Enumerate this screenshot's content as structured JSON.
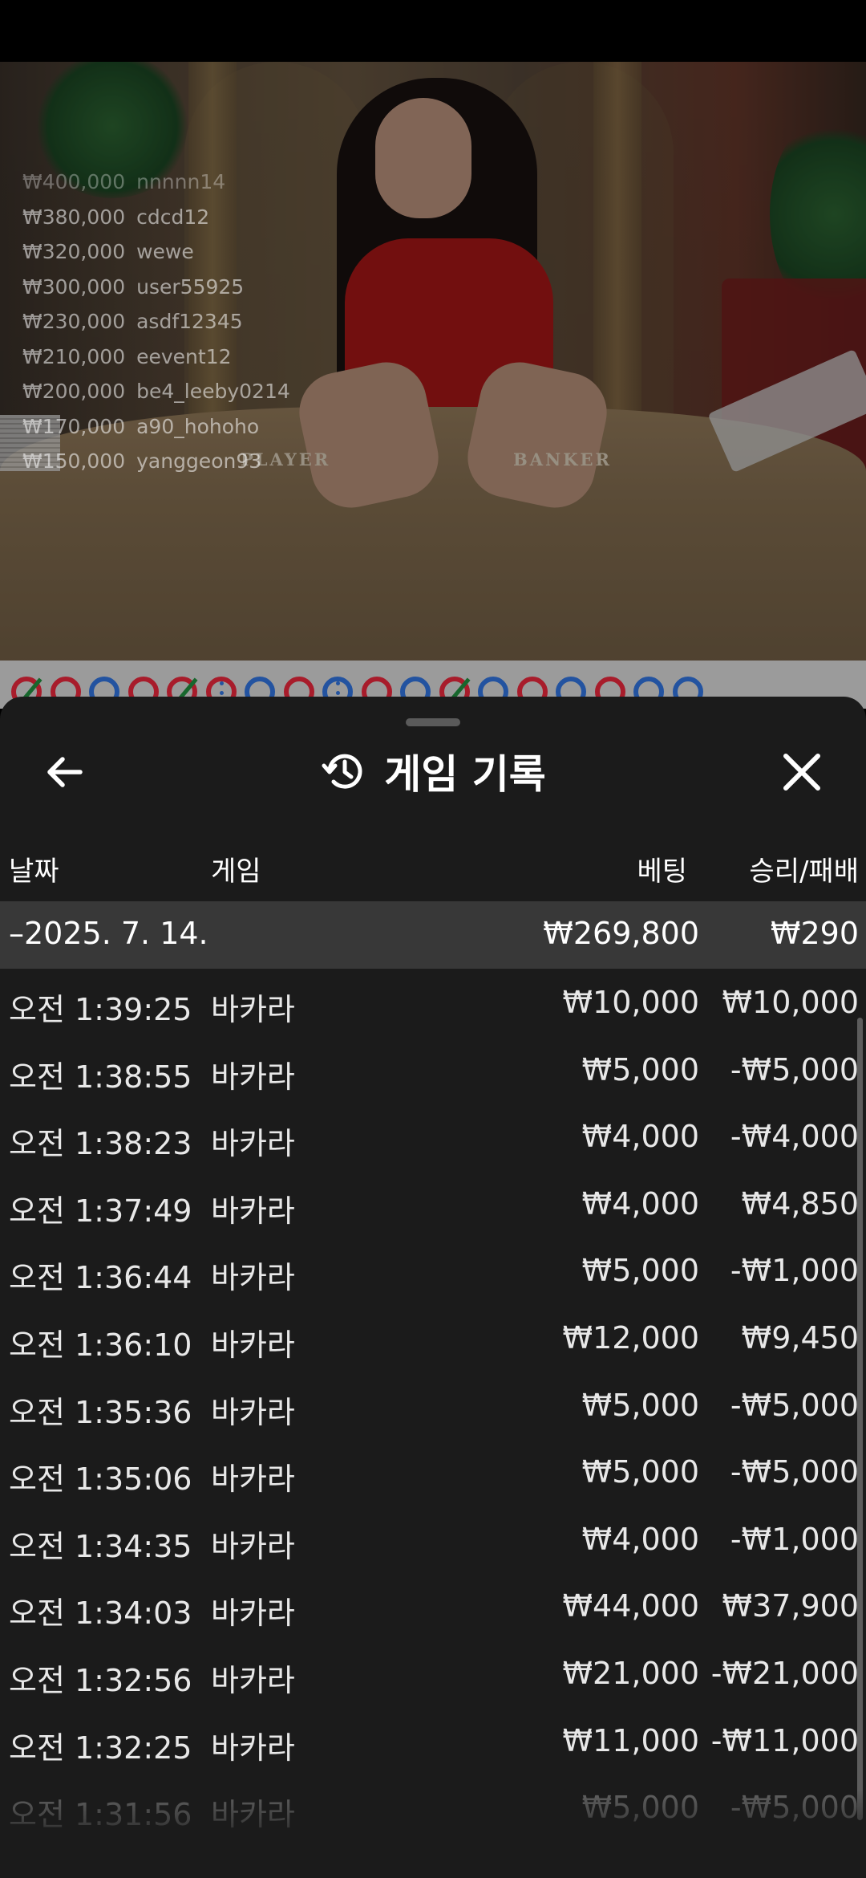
{
  "video": {
    "felt_player": "PLAYER",
    "felt_banker": "BANKER",
    "winners": [
      {
        "amount": "₩400,000",
        "user": "nnnnn14"
      },
      {
        "amount": "₩380,000",
        "user": "cdcd12"
      },
      {
        "amount": "₩320,000",
        "user": "wewe"
      },
      {
        "amount": "₩300,000",
        "user": "user55925"
      },
      {
        "amount": "₩230,000",
        "user": "asdf12345"
      },
      {
        "amount": "₩210,000",
        "user": "eevent12"
      },
      {
        "amount": "₩200,000",
        "user": "be4_leeby0214"
      },
      {
        "amount": "₩170,000",
        "user": "a90_hohoho"
      },
      {
        "amount": "₩150,000",
        "user": "yanggeon93"
      }
    ]
  },
  "sheet": {
    "title": "게임 기록",
    "icons": {
      "back": "arrow-left-icon",
      "history": "history-icon",
      "close": "close-icon"
    },
    "columns": {
      "date": "날짜",
      "game": "게임",
      "bet": "베팅",
      "result": "승리/패배"
    },
    "group": {
      "date": "–2025. 7. 14.",
      "bet": "₩269,800",
      "result": "₩290"
    },
    "rows": [
      {
        "time": "오전 1:39:25",
        "game": "바카라",
        "bet": "₩10,000",
        "result": "₩10,000"
      },
      {
        "time": "오전 1:38:55",
        "game": "바카라",
        "bet": "₩5,000",
        "result": "-₩5,000"
      },
      {
        "time": "오전 1:38:23",
        "game": "바카라",
        "bet": "₩4,000",
        "result": "-₩4,000"
      },
      {
        "time": "오전 1:37:49",
        "game": "바카라",
        "bet": "₩4,000",
        "result": "₩4,850"
      },
      {
        "time": "오전 1:36:44",
        "game": "바카라",
        "bet": "₩5,000",
        "result": "-₩1,000"
      },
      {
        "time": "오전 1:36:10",
        "game": "바카라",
        "bet": "₩12,000",
        "result": "₩9,450"
      },
      {
        "time": "오전 1:35:36",
        "game": "바카라",
        "bet": "₩5,000",
        "result": "-₩5,000"
      },
      {
        "time": "오전 1:35:06",
        "game": "바카라",
        "bet": "₩5,000",
        "result": "-₩5,000"
      },
      {
        "time": "오전 1:34:35",
        "game": "바카라",
        "bet": "₩4,000",
        "result": "-₩1,000"
      },
      {
        "time": "오전 1:34:03",
        "game": "바카라",
        "bet": "₩44,000",
        "result": "₩37,900"
      },
      {
        "time": "오전 1:32:56",
        "game": "바카라",
        "bet": "₩21,000",
        "result": "-₩21,000"
      },
      {
        "time": "오전 1:32:25",
        "game": "바카라",
        "bet": "₩11,000",
        "result": "-₩11,000"
      },
      {
        "time": "오전 1:31:56",
        "game": "바카라",
        "bet": "₩5,000",
        "result": "-₩5,000"
      }
    ]
  },
  "colors": {
    "sheet_bg": "#1b1b1b",
    "group_bg": "#383838",
    "bead_red": "#e0263a",
    "bead_blue": "#2f6fd6",
    "tie_green": "#1f8a3c"
  }
}
